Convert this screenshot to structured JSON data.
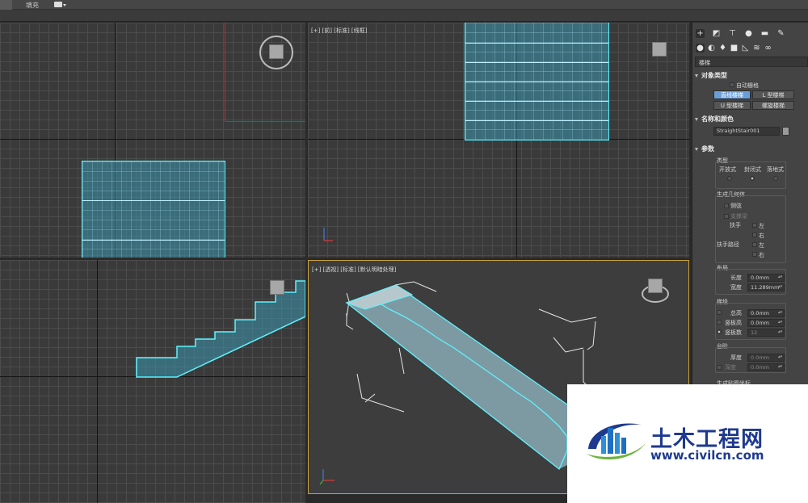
{
  "app": {
    "toolbar": {
      "fill_label": "填充"
    }
  },
  "viewports": {
    "front_label": "[+] [前] [标准] [线框]",
    "persp_label": "[+] [透视] [标准] [默认明暗处理]"
  },
  "panel": {
    "category": "楼梯",
    "object_type": {
      "title": "对象类型",
      "autogrid": "自动栅格",
      "buttons": [
        "直线楼梯",
        "L 型楼梯",
        "U 型楼梯",
        "螺旋楼梯"
      ],
      "selected": "直线楼梯"
    },
    "name_color": {
      "title": "名称和颜色",
      "name": "StraightStair001",
      "color": "#9a9a9a"
    },
    "params": {
      "title": "参数",
      "type_group": "类型",
      "type_options": [
        "开放式",
        "封闭式",
        "落地式"
      ],
      "type_selected": "封闭式",
      "geometry_group": "生成几何体",
      "stringers": "侧弦",
      "carriage": "支撑梁",
      "handrail": "扶手",
      "handrail_path": "扶手路径",
      "left": "左",
      "right": "右",
      "layout_group": "布局",
      "length_label": "长度",
      "length_value": "0.0mm",
      "width_label": "宽度",
      "width_value": "11.289mm",
      "rise_group": "梯级",
      "overall_label": "总高",
      "overall_value": "0.0mm",
      "riser_ht_label": "竖板高",
      "riser_ht_value": "0.0mm",
      "riser_ct_label": "竖板数",
      "riser_ct_value": "12",
      "steps_group": "台阶",
      "thickness_label": "厚度",
      "thickness_value": "0.0mm",
      "depth_label": "深度",
      "depth_value": "0.0mm",
      "cut_label": "生成贴图坐标"
    }
  },
  "watermark": {
    "title": "土木工程网",
    "url": "www.civilcn.com"
  }
}
